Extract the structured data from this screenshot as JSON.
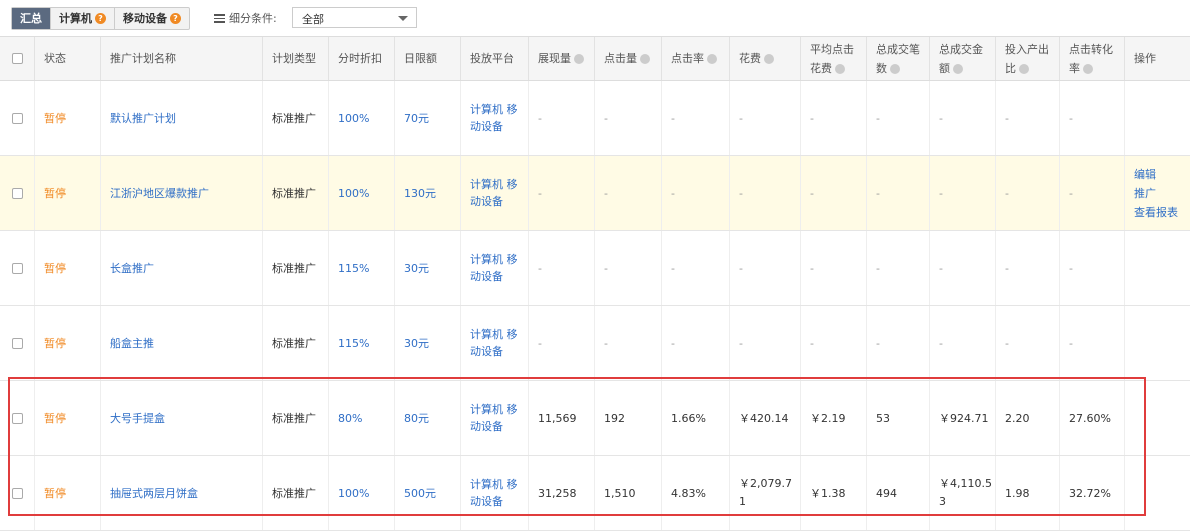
{
  "tabs": [
    {
      "label": "汇总",
      "active": true,
      "help": false
    },
    {
      "label": "计算机",
      "active": false,
      "help": true
    },
    {
      "label": "移动设备",
      "active": false,
      "help": true
    }
  ],
  "filter": {
    "label": "细分条件:",
    "selected": "全部"
  },
  "columns": [
    {
      "label": "",
      "help": false
    },
    {
      "label": "状态",
      "help": false
    },
    {
      "label": "推广计划名称",
      "help": false
    },
    {
      "label": "计划类型",
      "help": false
    },
    {
      "label": "分时折扣",
      "help": false
    },
    {
      "label": "日限额",
      "help": false
    },
    {
      "label": "投放平台",
      "help": false
    },
    {
      "label": "展现量",
      "help": true
    },
    {
      "label": "点击量",
      "help": true
    },
    {
      "label": "点击率",
      "help": true
    },
    {
      "label": "花费",
      "help": true
    },
    {
      "label": "平均点击花费",
      "line1": "平均点击",
      "line2": "花费",
      "help": true
    },
    {
      "label": "总成交笔数",
      "line1": "总成交笔",
      "line2": "数",
      "help": true
    },
    {
      "label": "总成交金额",
      "line1": "总成交金",
      "line2": "额",
      "help": true
    },
    {
      "label": "投入产出比",
      "line1": "投入产出",
      "line2": "比",
      "help": true
    },
    {
      "label": "点击转化率",
      "line1": "点击转化",
      "line2": "率",
      "help": true
    },
    {
      "label": "操作",
      "help": false
    }
  ],
  "rows": [
    {
      "status": "暂停",
      "name": "默认推广计划",
      "type": "标准推广",
      "discount": "100%",
      "limit": "70元",
      "platform1": "计算机 移",
      "platform2": "动设备",
      "impressions": "-",
      "clicks": "-",
      "ctr": "-",
      "cost": "-",
      "cpc": "-",
      "orders": "-",
      "gmv": "-",
      "roi": "-",
      "cvr": "-"
    },
    {
      "status": "暂停",
      "name": "江浙沪地区爆款推广",
      "type": "标准推广",
      "discount": "100%",
      "limit": "130元",
      "platform1": "计算机 移",
      "platform2": "动设备",
      "impressions": "-",
      "clicks": "-",
      "ctr": "-",
      "cost": "-",
      "cpc": "-",
      "orders": "-",
      "gmv": "-",
      "roi": "-",
      "cvr": "-"
    },
    {
      "status": "暂停",
      "name": "长盒推广",
      "type": "标准推广",
      "discount": "115%",
      "limit": "30元",
      "platform1": "计算机 移",
      "platform2": "动设备",
      "impressions": "-",
      "clicks": "-",
      "ctr": "-",
      "cost": "-",
      "cpc": "-",
      "orders": "-",
      "gmv": "-",
      "roi": "-",
      "cvr": "-"
    },
    {
      "status": "暂停",
      "name": "船盒主推",
      "type": "标准推广",
      "discount": "115%",
      "limit": "30元",
      "platform1": "计算机 移",
      "platform2": "动设备",
      "impressions": "-",
      "clicks": "-",
      "ctr": "-",
      "cost": "-",
      "cpc": "-",
      "orders": "-",
      "gmv": "-",
      "roi": "-",
      "cvr": "-"
    },
    {
      "status": "暂停",
      "name": "大号手提盒",
      "type": "标准推广",
      "discount": "80%",
      "limit": "80元",
      "platform1": "计算机 移",
      "platform2": "动设备",
      "impressions": "11,569",
      "clicks": "192",
      "ctr": "1.66%",
      "cost": "￥420.14",
      "cpc": "￥2.19",
      "orders": "53",
      "gmv": "￥924.71",
      "roi": "2.20",
      "cvr": "27.60%"
    },
    {
      "status": "暂停",
      "name": "抽屉式两层月饼盒",
      "type": "标准推广",
      "discount": "100%",
      "limit": "500元",
      "platform1": "计算机 移",
      "platform2": "动设备",
      "impressions": "31,258",
      "clicks": "1,510",
      "ctr": "4.83%",
      "cost": "￥2,079.71",
      "cost1": "￥2,079.7",
      "cost2": "1",
      "cpc": "￥1.38",
      "orders": "494",
      "gmv": "￥4,110.53",
      "gmv1": "￥4,110.5",
      "gmv2": "3",
      "roi": "1.98",
      "cvr": "32.72%"
    }
  ],
  "operations": [
    "编辑",
    "推广",
    "查看报表"
  ]
}
